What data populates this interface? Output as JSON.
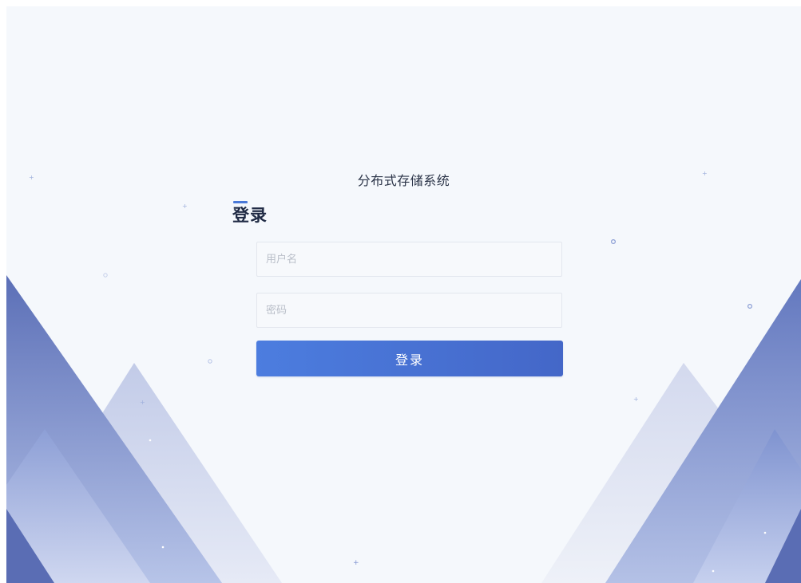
{
  "app": {
    "title": "分布式存储系统"
  },
  "login": {
    "heading": "登录",
    "username_placeholder": "用户名",
    "username_value": "",
    "password_placeholder": "密码",
    "password_value": "",
    "submit_label": "登录"
  },
  "theme": {
    "background": "#f5f8fc",
    "button_start": "#4c7ddf",
    "button_end": "#4467c8",
    "mountain_dark": "#6c80c2",
    "mountain_light": "#dfe4f2"
  }
}
